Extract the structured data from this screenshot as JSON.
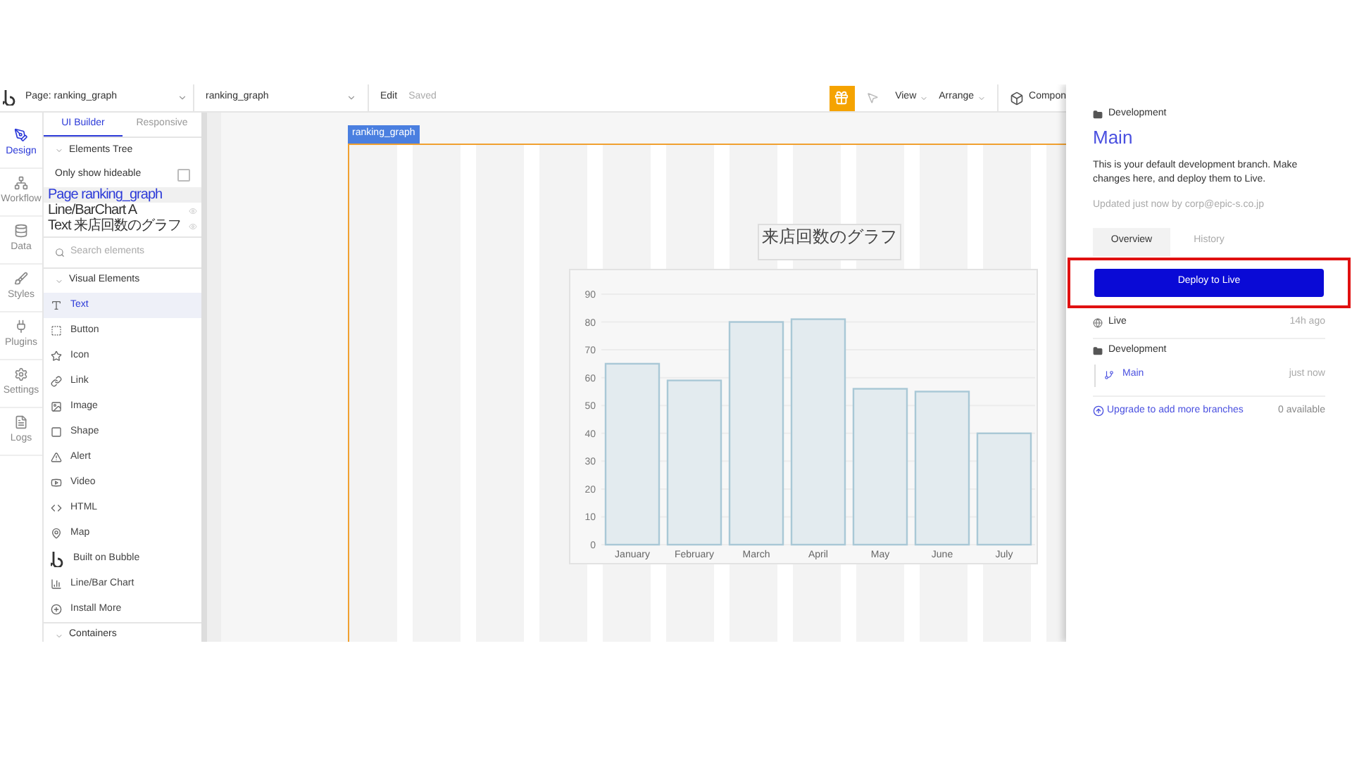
{
  "toolbar": {
    "page_select": "Page: ranking_graph",
    "element_select": "ranking_graph",
    "edit": "Edit",
    "saved": "Saved",
    "view": "View",
    "arrange": "Arrange",
    "components": "Compon"
  },
  "rail": [
    {
      "label": "Design",
      "selected": true
    },
    {
      "label": "Workflow",
      "selected": false
    },
    {
      "label": "Data",
      "selected": false
    },
    {
      "label": "Styles",
      "selected": false
    },
    {
      "label": "Plugins",
      "selected": false
    },
    {
      "label": "Settings",
      "selected": false
    },
    {
      "label": "Logs",
      "selected": false
    }
  ],
  "panel_tabs": [
    {
      "label": "UI Builder",
      "selected": true
    },
    {
      "label": "Responsive",
      "selected": false
    }
  ],
  "elements_tree": {
    "title": "Elements Tree",
    "only_hideable": {
      "label": "Only show hideable",
      "checked": false
    },
    "items": [
      {
        "label": "Page ranking_graph",
        "selected": true,
        "eye": false
      },
      {
        "label": "Line/BarChart A",
        "selected": false,
        "eye": true
      },
      {
        "label": "Text 来店回数のグラフ",
        "selected": false,
        "eye": true
      }
    ]
  },
  "search": {
    "placeholder": "Search elements"
  },
  "visual_elements": {
    "title": "Visual Elements",
    "items": [
      {
        "label": "Text",
        "selected": true
      },
      {
        "label": "Button",
        "selected": false
      },
      {
        "label": "Icon",
        "selected": false
      },
      {
        "label": "Link",
        "selected": false
      },
      {
        "label": "Image",
        "selected": false
      },
      {
        "label": "Shape",
        "selected": false
      },
      {
        "label": "Alert",
        "selected": false
      },
      {
        "label": "Video",
        "selected": false
      },
      {
        "label": "HTML",
        "selected": false
      },
      {
        "label": "Map",
        "selected": false
      },
      {
        "label": "Built on Bubble",
        "selected": false
      },
      {
        "label": "Line/Bar Chart",
        "selected": false
      },
      {
        "label": "Install More",
        "selected": false
      }
    ]
  },
  "containers": {
    "title": "Containers"
  },
  "canvas": {
    "page_label": "ranking_graph",
    "chart_title": "来店回数のグラフ",
    "chart": {
      "chart_data": {
        "type": "bar",
        "grid": true,
        "categories": [
          "January",
          "February",
          "March",
          "April",
          "May",
          "June",
          "July"
        ],
        "series": [
          {
            "color": "#a9c8d6",
            "values": [
              65,
              59,
              80,
              81,
              56,
              55,
              40
            ]
          }
        ],
        "ylim": [
          0,
          90
        ],
        "yticks": [
          0,
          10,
          20,
          30,
          40,
          50,
          60,
          70,
          80,
          90
        ]
      }
    }
  },
  "branch_panel": {
    "group": "Development",
    "title": "Main",
    "description": "This is your default development branch. Make changes here, and deploy them to Live.",
    "updated": "Updated just now by corp@epic-s.co.jp",
    "tabs": [
      {
        "label": "Overview",
        "selected": true
      },
      {
        "label": "History",
        "selected": false
      }
    ],
    "deploy": {
      "label": "Deploy to Live",
      "highlighted": true
    },
    "live": {
      "label": "Live",
      "time": "14h ago"
    },
    "development": {
      "label": "Development",
      "branches": [
        {
          "label": "Main",
          "time": "just now"
        }
      ]
    },
    "upgrade": {
      "label": "Upgrade to add more branches",
      "count": "0 available"
    }
  }
}
